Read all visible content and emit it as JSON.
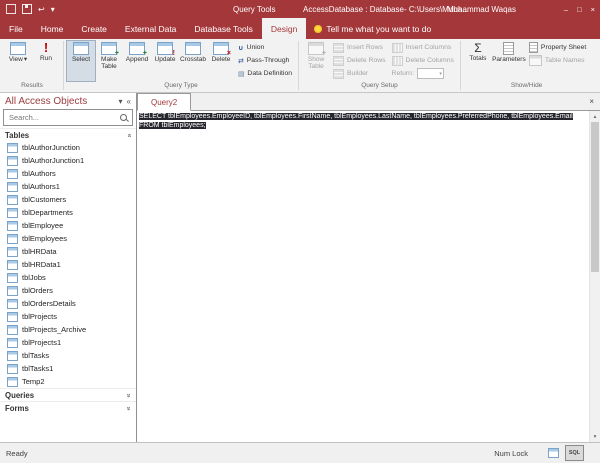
{
  "accent": "#a4373a",
  "titlebar": {
    "tools": "Query Tools",
    "title": "AccessDatabase : Database- C:\\Users\\Muha...",
    "user": "Muhammad Waqas"
  },
  "ribbon": {
    "tabs": [
      {
        "label": "File",
        "active": false
      },
      {
        "label": "Home",
        "active": false
      },
      {
        "label": "Create",
        "active": false
      },
      {
        "label": "External Data",
        "active": false
      },
      {
        "label": "Database Tools",
        "active": false
      },
      {
        "label": "Design",
        "active": true
      }
    ],
    "tell_me": "Tell me what you want to do",
    "results": {
      "label": "Results",
      "view": "View",
      "run": "Run"
    },
    "query_type": {
      "label": "Query Type",
      "select": "Select",
      "make_table": "Make Table",
      "append": "Append",
      "update": "Update",
      "crosstab": "Crosstab",
      "delete": "Delete",
      "union": "Union",
      "pass_through": "Pass-Through",
      "data_definition": "Data Definition"
    },
    "query_setup": {
      "label": "Query Setup",
      "show_table": "Show Table",
      "insert_rows": "Insert Rows",
      "delete_rows": "Delete Rows",
      "builder": "Builder",
      "insert_columns": "Insert Columns",
      "delete_columns": "Delete Columns",
      "return_label": "Return:"
    },
    "show_hide": {
      "label": "Show/Hide",
      "totals": "Totals",
      "parameters": "Parameters",
      "property_sheet": "Property Sheet",
      "table_names": "Table Names"
    }
  },
  "sidebar": {
    "title": "All Access Objects",
    "search_placeholder": "Search...",
    "tables_header": "Tables",
    "queries_header": "Queries",
    "forms_header": "Forms",
    "tables": [
      "tblAuthorJunction",
      "tblAuthorJunction1",
      "tblAuthors",
      "tblAuthors1",
      "tblCustomers",
      "tblDepartments",
      "tblEmployee",
      "tblEmployees",
      "tblHRData",
      "tblHRData1",
      "tblJobs",
      "tblOrders",
      "tblOrdersDetails",
      "tblProjects",
      "tblProjects_Archive",
      "tblProjects1",
      "tblTasks",
      "tblTasks1",
      "Temp2"
    ]
  },
  "main": {
    "tab": "Query2",
    "sql_line1": "SELECT tblEmployees.EmployeeID, tblEmployees.FirstName, tblEmployees.LastName, tblEmployees.PreferredPhone, tblEmployees.Email",
    "sql_line2": "FROM tblEmployees;"
  },
  "statusbar": {
    "ready": "Ready",
    "num_lock": "Num Lock"
  }
}
